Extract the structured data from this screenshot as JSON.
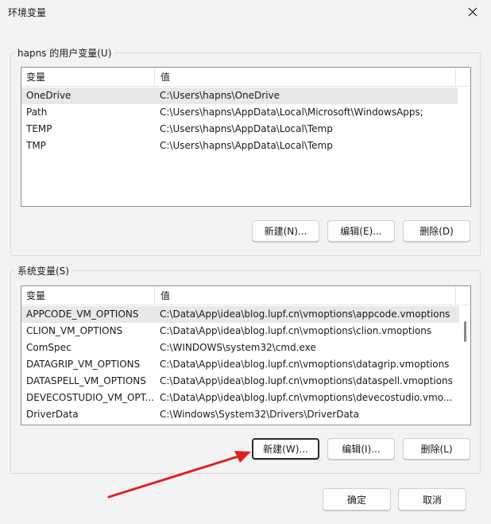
{
  "window": {
    "title": "环境变量",
    "close_icon": "close-icon"
  },
  "user_section": {
    "label": "hapns 的用户变量(U)",
    "columns": {
      "name": "变量",
      "value": "值"
    },
    "rows": [
      {
        "name": "OneDrive",
        "value": "C:\\Users\\hapns\\OneDrive",
        "selected": true
      },
      {
        "name": "Path",
        "value": "C:\\Users\\hapns\\AppData\\Local\\Microsoft\\WindowsApps;"
      },
      {
        "name": "TEMP",
        "value": "C:\\Users\\hapns\\AppData\\Local\\Temp"
      },
      {
        "name": "TMP",
        "value": "C:\\Users\\hapns\\AppData\\Local\\Temp"
      }
    ],
    "buttons": {
      "new": "新建(N)...",
      "edit": "编辑(E)...",
      "delete": "删除(D)"
    }
  },
  "system_section": {
    "label": "系统变量(S)",
    "columns": {
      "name": "变量",
      "value": "值"
    },
    "rows": [
      {
        "name": "APPCODE_VM_OPTIONS",
        "value": "C:\\Data\\App\\idea\\blog.lupf.cn\\vmoptions\\appcode.vmoptions",
        "selected": true
      },
      {
        "name": "CLION_VM_OPTIONS",
        "value": "C:\\Data\\App\\idea\\blog.lupf.cn\\vmoptions\\clion.vmoptions"
      },
      {
        "name": "ComSpec",
        "value": "C:\\WINDOWS\\system32\\cmd.exe"
      },
      {
        "name": "DATAGRIP_VM_OPTIONS",
        "value": "C:\\Data\\App\\idea\\blog.lupf.cn\\vmoptions\\datagrip.vmoptions"
      },
      {
        "name": "DATASPELL_VM_OPTIONS",
        "value": "C:\\Data\\App\\idea\\blog.lupf.cn\\vmoptions\\dataspell.vmoptions"
      },
      {
        "name": "DEVECOSTUDIO_VM_OPT...",
        "value": "C:\\Data\\App\\idea\\blog.lupf.cn\\vmoptions\\devecostudio.vmo..."
      },
      {
        "name": "DriverData",
        "value": "C:\\Windows\\System32\\Drivers\\DriverData"
      }
    ],
    "buttons": {
      "new": "新建(W)...",
      "edit": "编辑(I)...",
      "delete": "删除(L)"
    }
  },
  "footer": {
    "ok": "确定",
    "cancel": "取消"
  },
  "colors": {
    "annotation_arrow": "#e02020",
    "selection": "#e8e8e8"
  }
}
